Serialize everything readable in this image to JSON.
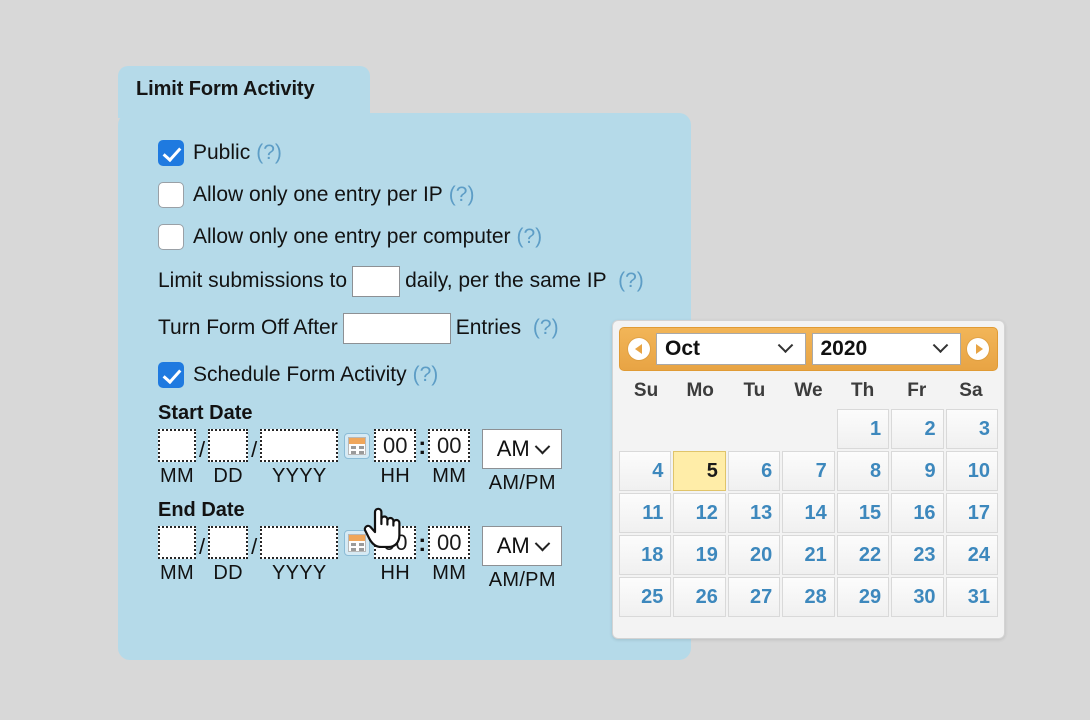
{
  "panel": {
    "title": "Limit Form Activity",
    "help_marker": "(?)",
    "checkboxes": [
      {
        "label": "Public",
        "checked": true
      },
      {
        "label": "Allow only one entry per IP",
        "checked": false
      },
      {
        "label": "Allow only one entry per computer",
        "checked": false
      }
    ],
    "limit_submissions": {
      "prefix": "Limit submissions to",
      "value": "",
      "suffix": "daily, per the same IP"
    },
    "turn_off": {
      "prefix": "Turn Form Off After",
      "value": "",
      "suffix": "Entries"
    },
    "schedule": {
      "label": "Schedule Form Activity",
      "checked": true
    },
    "start_date": {
      "heading": "Start Date",
      "mm": "",
      "dd": "",
      "yyyy": "",
      "hh": "00",
      "mi": "00",
      "ampm": "AM",
      "caps": {
        "mm": "MM",
        "dd": "DD",
        "yyyy": "YYYY",
        "hh": "HH",
        "mi": "MM",
        "ampm": "AM/PM"
      },
      "separator": "/",
      "time_separator": ":"
    },
    "end_date": {
      "heading": "End Date",
      "mm": "",
      "dd": "",
      "yyyy": "",
      "hh": "00",
      "mi": "00",
      "ampm": "AM",
      "caps": {
        "mm": "MM",
        "dd": "DD",
        "yyyy": "YYYY",
        "hh": "HH",
        "mi": "MM",
        "ampm": "AM/PM"
      },
      "separator": "/",
      "time_separator": ":"
    }
  },
  "calendar": {
    "month": "Oct",
    "year": "2020",
    "prev_label": "◀",
    "next_label": "▶",
    "day_headers": [
      "Su",
      "Mo",
      "Tu",
      "We",
      "Th",
      "Fr",
      "Sa"
    ],
    "leading_blanks": 4,
    "days": [
      1,
      2,
      3,
      4,
      5,
      6,
      7,
      8,
      9,
      10,
      11,
      12,
      13,
      14,
      15,
      16,
      17,
      18,
      19,
      20,
      21,
      22,
      23,
      24,
      25,
      26,
      27,
      28,
      29,
      30,
      31
    ],
    "selected_day": 5
  },
  "colors": {
    "panel_bg": "#b5dae9",
    "page_bg": "#d8d8d8",
    "accent_blue": "#1f7ae0",
    "help_link": "#5d9dc6",
    "calendar_header": "#e8a444",
    "day_number": "#3d88bd",
    "selected_day_bg": "#ffeda8"
  }
}
